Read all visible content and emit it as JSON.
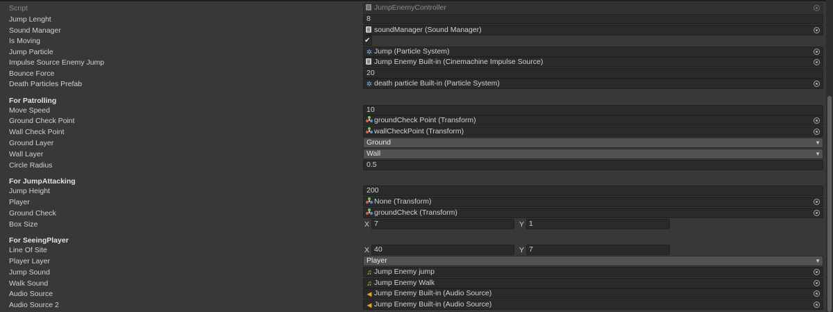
{
  "rows": {
    "script": {
      "label": "Script",
      "value": "JumpEnemyController"
    },
    "jump_length": {
      "label": "Jump Lenght",
      "value": "8"
    },
    "sound_manager": {
      "label": "Sound Manager",
      "value": "soundManager (Sound Manager)"
    },
    "is_moving": {
      "label": "Is Moving",
      "checked": true,
      "mark": "✔"
    },
    "jump_particle": {
      "label": "Jump Particle",
      "value": "Jump (Particle System)"
    },
    "impulse_source": {
      "label": "Impulse Source Enemy Jump",
      "value": "Jump Enemy Built-in (Cinemachine Impulse Source)"
    },
    "bounce_force": {
      "label": "Bounce Force",
      "value": "20"
    },
    "death_particles": {
      "label": "Death Particles Prefab",
      "value": "death particle Built-in (Particle System)"
    },
    "patrolling_header": {
      "label": "For Patrolling"
    },
    "move_speed": {
      "label": "Move Speed",
      "value": "10"
    },
    "ground_check_point": {
      "label": "Ground Check Point",
      "value": "groundCheck Point (Transform)"
    },
    "wall_check_point": {
      "label": "Wall Check Point",
      "value": "wallCheckPoint (Transform)"
    },
    "ground_layer": {
      "label": "Ground Layer",
      "value": "Ground"
    },
    "wall_layer": {
      "label": "Wall Layer",
      "value": "Wall"
    },
    "circle_radius": {
      "label": "Circle Radius",
      "value": "0.5"
    },
    "jumpattacking_header": {
      "label": "For JumpAttacking"
    },
    "jump_height": {
      "label": "Jump Height",
      "value": "200"
    },
    "player": {
      "label": "Player",
      "value": "None (Transform)"
    },
    "ground_check": {
      "label": "Ground Check",
      "value": "groundCheck (Transform)"
    },
    "box_size": {
      "label": "Box Size",
      "x_label": "X",
      "x": "7",
      "y_label": "Y",
      "y": "1"
    },
    "seeingplayer_header": {
      "label": "For SeeingPlayer"
    },
    "line_of_site": {
      "label": "Line Of Site",
      "x_label": "X",
      "x": "40",
      "y_label": "Y",
      "y": "7"
    },
    "player_layer": {
      "label": "Player Layer",
      "value": "Player"
    },
    "jump_sound": {
      "label": "Jump Sound",
      "value": "Jump Enemy jump"
    },
    "walk_sound": {
      "label": "Walk Sound",
      "value": "Jump Enemy Walk"
    },
    "audio_source": {
      "label": "Audio Source",
      "value": "Jump Enemy Built-in (Audio Source)"
    },
    "audio_source_2": {
      "label": "Audio Source 2",
      "value": "Jump Enemy Built-in (Audio Source)"
    }
  },
  "icons": {
    "particle_glyph": "✲",
    "music_glyph": "♫",
    "speaker_glyph": "◀",
    "caret_glyph": "▼"
  },
  "colors": {
    "background": "#383838",
    "field": "#2a2a2a",
    "dropdown": "#515151",
    "text": "#d2d2d2"
  }
}
